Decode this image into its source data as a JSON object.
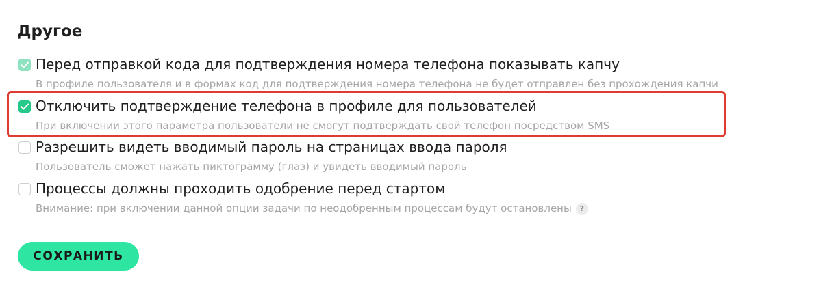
{
  "section": {
    "title": "Другое"
  },
  "options": [
    {
      "label": "Перед отправкой кода для подтверждения номера телефона показывать капчу",
      "description": "В профиле пользователя и в формах код для подтверждения номера телефона не будет отправлен без прохождения капчи",
      "checked": true,
      "disabled": true
    },
    {
      "label": "Отключить подтверждение телефона в профиле для пользователей",
      "description": "При включении этого параметра пользователи не смогут подтверждать свой телефон посредством SMS",
      "checked": true,
      "highlighted": true
    },
    {
      "label": "Разрешить видеть вводимый пароль на страницах ввода пароля",
      "description": "Пользователь сможет нажать пиктограмму (глаз) и увидеть вводимый пароль",
      "checked": false
    },
    {
      "label": "Процессы должны проходить одобрение перед стартом",
      "description": "Внимание: при включении данной опции задачи по неодобренным процессам будут остановлены",
      "checked": false,
      "help_icon": "?"
    }
  ],
  "actions": {
    "save_label": "СОХРАНИТЬ"
  },
  "colors": {
    "accent": "#2ee6a1",
    "checkbox_checked": "#25c98a",
    "checkbox_checked_faded": "#8ee2c0",
    "highlight": "#de3b32",
    "text_primary": "#1f1f1f",
    "text_secondary": "#a6a6a6"
  }
}
